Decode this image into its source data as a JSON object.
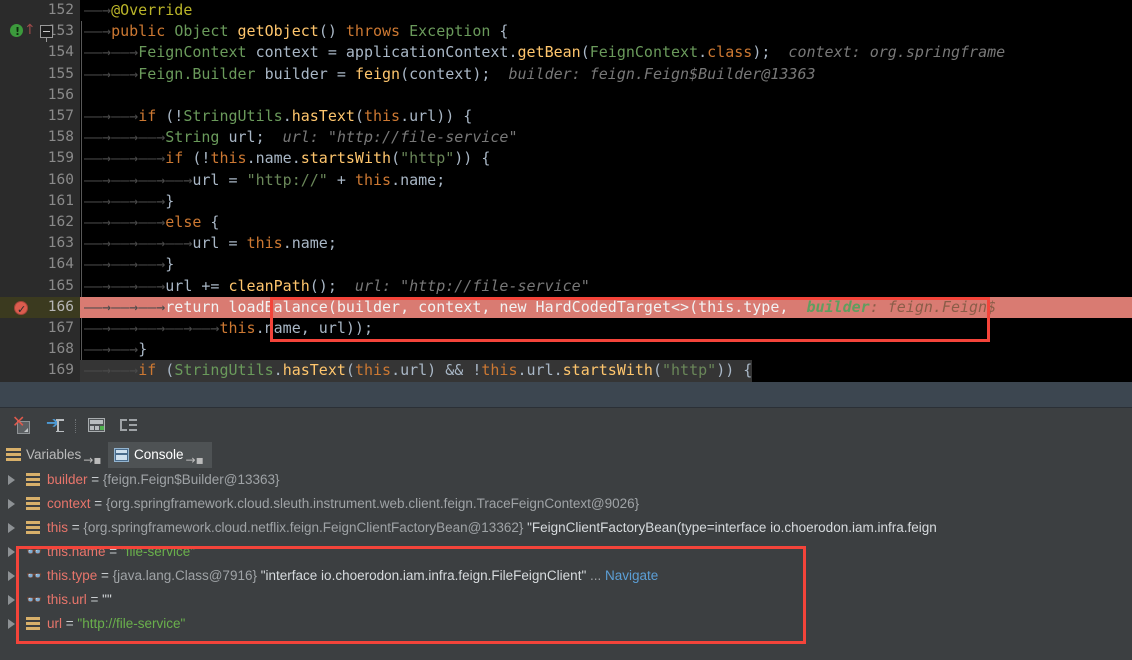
{
  "editor": {
    "lines": [
      {
        "num": "152",
        "indent_tabs": 1,
        "tokens": [
          {
            "t": "@Override",
            "c": "ann"
          }
        ]
      },
      {
        "num": "153",
        "indent_tabs": 1,
        "gutter_icons": [
          "inspection-badge-icon",
          "arrow-up-icon",
          "fold-collapse-icon"
        ],
        "tokens": [
          {
            "t": "public",
            "c": "kw"
          },
          {
            "t": " ",
            "c": "pln"
          },
          {
            "t": "Object",
            "c": "cls"
          },
          {
            "t": " ",
            "c": "pln"
          },
          {
            "t": "getObject",
            "c": "meth"
          },
          {
            "t": "() ",
            "c": "punct"
          },
          {
            "t": "throws",
            "c": "kw"
          },
          {
            "t": " ",
            "c": "pln"
          },
          {
            "t": "Exception",
            "c": "cls"
          },
          {
            "t": " {",
            "c": "punct"
          }
        ]
      },
      {
        "num": "154",
        "indent_tabs": 2,
        "tokens": [
          {
            "t": "FeignContext",
            "c": "cls"
          },
          {
            "t": " context = applicationContext.",
            "c": "pln"
          },
          {
            "t": "getBean",
            "c": "meth"
          },
          {
            "t": "(",
            "c": "punct"
          },
          {
            "t": "FeignContext",
            "c": "cls"
          },
          {
            "t": ".",
            "c": "punct"
          },
          {
            "t": "class",
            "c": "kw"
          },
          {
            "t": ");",
            "c": "punct"
          }
        ],
        "hint": "  context: org.springframe"
      },
      {
        "num": "155",
        "indent_tabs": 2,
        "tokens": [
          {
            "t": "Feign.Builder",
            "c": "cls"
          },
          {
            "t": " builder = ",
            "c": "pln"
          },
          {
            "t": "feign",
            "c": "meth"
          },
          {
            "t": "(context);",
            "c": "punct"
          }
        ],
        "hint": "  builder: feign.Feign$Builder@13363"
      },
      {
        "num": "156",
        "indent_tabs": 0,
        "tokens": []
      },
      {
        "num": "157",
        "indent_tabs": 2,
        "tokens": [
          {
            "t": "if",
            "c": "kw"
          },
          {
            "t": " (!",
            "c": "punct"
          },
          {
            "t": "StringUtils",
            "c": "cls"
          },
          {
            "t": ".",
            "c": "punct"
          },
          {
            "t": "hasText",
            "c": "meth"
          },
          {
            "t": "(",
            "c": "punct"
          },
          {
            "t": "this",
            "c": "kw"
          },
          {
            "t": ".url)) {",
            "c": "punct"
          }
        ]
      },
      {
        "num": "158",
        "indent_tabs": 3,
        "tokens": [
          {
            "t": "String",
            "c": "cls"
          },
          {
            "t": " url;",
            "c": "pln"
          }
        ],
        "hint": "  url: \"http://file-service\""
      },
      {
        "num": "159",
        "indent_tabs": 3,
        "tokens": [
          {
            "t": "if",
            "c": "kw"
          },
          {
            "t": " (!",
            "c": "punct"
          },
          {
            "t": "this",
            "c": "kw"
          },
          {
            "t": ".name.",
            "c": "punct"
          },
          {
            "t": "startsWith",
            "c": "meth"
          },
          {
            "t": "(",
            "c": "punct"
          },
          {
            "t": "\"http\"",
            "c": "str"
          },
          {
            "t": ")) {",
            "c": "punct"
          }
        ]
      },
      {
        "num": "160",
        "indent_tabs": 4,
        "tokens": [
          {
            "t": "url = ",
            "c": "pln"
          },
          {
            "t": "\"http://\"",
            "c": "str"
          },
          {
            "t": " + ",
            "c": "pln"
          },
          {
            "t": "this",
            "c": "kw"
          },
          {
            "t": ".name;",
            "c": "punct"
          }
        ]
      },
      {
        "num": "161",
        "indent_tabs": 3,
        "tokens": [
          {
            "t": "}",
            "c": "punct"
          }
        ]
      },
      {
        "num": "162",
        "indent_tabs": 3,
        "tokens": [
          {
            "t": "else",
            "c": "kw"
          },
          {
            "t": " {",
            "c": "punct"
          }
        ]
      },
      {
        "num": "163",
        "indent_tabs": 4,
        "tokens": [
          {
            "t": "url = ",
            "c": "pln"
          },
          {
            "t": "this",
            "c": "kw"
          },
          {
            "t": ".name;",
            "c": "punct"
          }
        ]
      },
      {
        "num": "164",
        "indent_tabs": 3,
        "tokens": [
          {
            "t": "}",
            "c": "punct"
          }
        ]
      },
      {
        "num": "165",
        "indent_tabs": 3,
        "tokens": [
          {
            "t": "url += ",
            "c": "pln"
          },
          {
            "t": "cleanPath",
            "c": "meth"
          },
          {
            "t": "();",
            "c": "punct"
          }
        ],
        "hint": "  url: \"http://file-service\""
      },
      {
        "num": "166",
        "indent_tabs": 3,
        "executing": true,
        "gutter_icons": [
          "breakpoint-hit-icon"
        ],
        "exec_text": "return loadBalance(builder, context, new HardCodedTarget<>(this.type,",
        "exec_param_hint": "builder",
        "exec_hint_tail": ": feign.Feign$",
        "tokens": []
      },
      {
        "num": "167",
        "indent_tabs": 5,
        "exec_cont": true,
        "tokens": [
          {
            "t": "this",
            "c": "kw"
          },
          {
            "t": ".name, url));",
            "c": "punct"
          }
        ]
      },
      {
        "num": "168",
        "indent_tabs": 2,
        "tokens": [
          {
            "t": "}",
            "c": "punct"
          }
        ]
      },
      {
        "num": "169",
        "indent_tabs": 2,
        "selected": true,
        "tokens": [
          {
            "t": "if",
            "c": "kw"
          },
          {
            "t": " (",
            "c": "punct"
          },
          {
            "t": "StringUtils",
            "c": "cls"
          },
          {
            "t": ".",
            "c": "punct"
          },
          {
            "t": "hasText",
            "c": "meth"
          },
          {
            "t": "(",
            "c": "punct"
          },
          {
            "t": "this",
            "c": "kw"
          },
          {
            "t": ".url) && !",
            "c": "punct"
          },
          {
            "t": "this",
            "c": "kw"
          },
          {
            "t": ".url.",
            "c": "punct"
          },
          {
            "t": "startsWith",
            "c": "meth"
          },
          {
            "t": "(",
            "c": "punct"
          },
          {
            "t": "\"http\"",
            "c": "str"
          },
          {
            "t": ")) {",
            "c": "punct"
          }
        ]
      }
    ]
  },
  "debug_toolbar": {
    "icons": [
      {
        "name": "mute-breakpoints-icon"
      },
      {
        "name": "jump-to-cursor-icon"
      },
      {
        "name": "evaluate-expression-icon"
      },
      {
        "name": "group-by-icon"
      }
    ]
  },
  "debug_tabs": [
    {
      "label": "Variables",
      "icon": "variables-icon",
      "active": false,
      "pin": "→▪"
    },
    {
      "label": "Console",
      "icon": "console-icon",
      "active": true,
      "pin": "→▪"
    }
  ],
  "variables": [
    {
      "icon": "field-icon",
      "highlighted": false,
      "parts": [
        {
          "t": "builder",
          "c": "vname"
        },
        {
          "t": " = ",
          "c": "veq"
        },
        {
          "t": "{feign.Feign$Builder@13363}",
          "c": "vref"
        }
      ]
    },
    {
      "icon": "field-icon",
      "highlighted": false,
      "parts": [
        {
          "t": "context",
          "c": "vname"
        },
        {
          "t": " = ",
          "c": "veq"
        },
        {
          "t": "{org.springframework.cloud.sleuth.instrument.web.client.feign.TraceFeignContext@9026}",
          "c": "vref"
        }
      ]
    },
    {
      "icon": "field-icon",
      "highlighted": false,
      "parts": [
        {
          "t": "this",
          "c": "vname"
        },
        {
          "t": " = ",
          "c": "veq"
        },
        {
          "t": "{org.springframework.cloud.netflix.feign.FeignClientFactoryBean@13362}",
          "c": "vref"
        },
        {
          "t": " \"FeignClientFactoryBean(type=interface io.choerodon.iam.infra.feign",
          "c": "vval"
        }
      ]
    },
    {
      "icon": "watch-icon",
      "highlighted": true,
      "parts": [
        {
          "t": "this.name",
          "c": "vname"
        },
        {
          "t": " = ",
          "c": "veq"
        },
        {
          "t": "\"file-service\"",
          "c": "vstr"
        }
      ]
    },
    {
      "icon": "watch-icon",
      "highlighted": true,
      "parts": [
        {
          "t": "this.type",
          "c": "vname"
        },
        {
          "t": " = ",
          "c": "veq"
        },
        {
          "t": "{java.lang.Class@7916}",
          "c": "vref"
        },
        {
          "t": " \"interface io.choerodon.iam.infra.feign.FileFeignClient\"",
          "c": "vval"
        },
        {
          "t": " ... ",
          "c": "vref"
        },
        {
          "t": "Navigate",
          "c": "vnav"
        }
      ]
    },
    {
      "icon": "watch-icon",
      "highlighted": true,
      "parts": [
        {
          "t": "this.url",
          "c": "vname"
        },
        {
          "t": " = ",
          "c": "veq"
        },
        {
          "t": "\"\"",
          "c": "vval"
        }
      ]
    },
    {
      "icon": "field-icon",
      "highlighted": true,
      "parts": [
        {
          "t": "url",
          "c": "vname"
        },
        {
          "t": " = ",
          "c": "veq"
        },
        {
          "t": "\"http://file-service\"",
          "c": "vstr"
        }
      ]
    }
  ],
  "annotations": {
    "code_box_label": "return-statement-highlight-box",
    "vars_box_label": "watched-variables-highlight-box",
    "accent_red": "#f4443a",
    "exec_line_bg": "#d97b72",
    "panel_bg": "#3c3f41"
  }
}
